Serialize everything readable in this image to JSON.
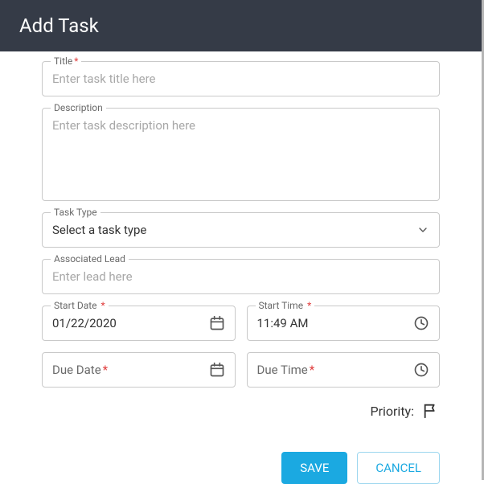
{
  "header": {
    "title": "Add Task"
  },
  "fields": {
    "title": {
      "label": "Title",
      "placeholder": "Enter task title here",
      "required": true
    },
    "description": {
      "label": "Description",
      "placeholder": "Enter task description here",
      "required": false
    },
    "taskType": {
      "label": "Task Type",
      "value": "Select a task type",
      "required": false
    },
    "lead": {
      "label": "Associated Lead",
      "placeholder": "Enter lead here",
      "required": false
    },
    "startDate": {
      "label": "Start Date",
      "value": "01/22/2020",
      "required": true
    },
    "startTime": {
      "label": "Start Time",
      "value": "11:49 AM",
      "required": true
    },
    "dueDate": {
      "label": "Due Date",
      "required": true
    },
    "dueTime": {
      "label": "Due Time",
      "required": true
    }
  },
  "priority": {
    "label": "Priority:"
  },
  "buttons": {
    "save": "SAVE",
    "cancel": "CANCEL"
  },
  "glyphs": {
    "asterisk": "*"
  }
}
